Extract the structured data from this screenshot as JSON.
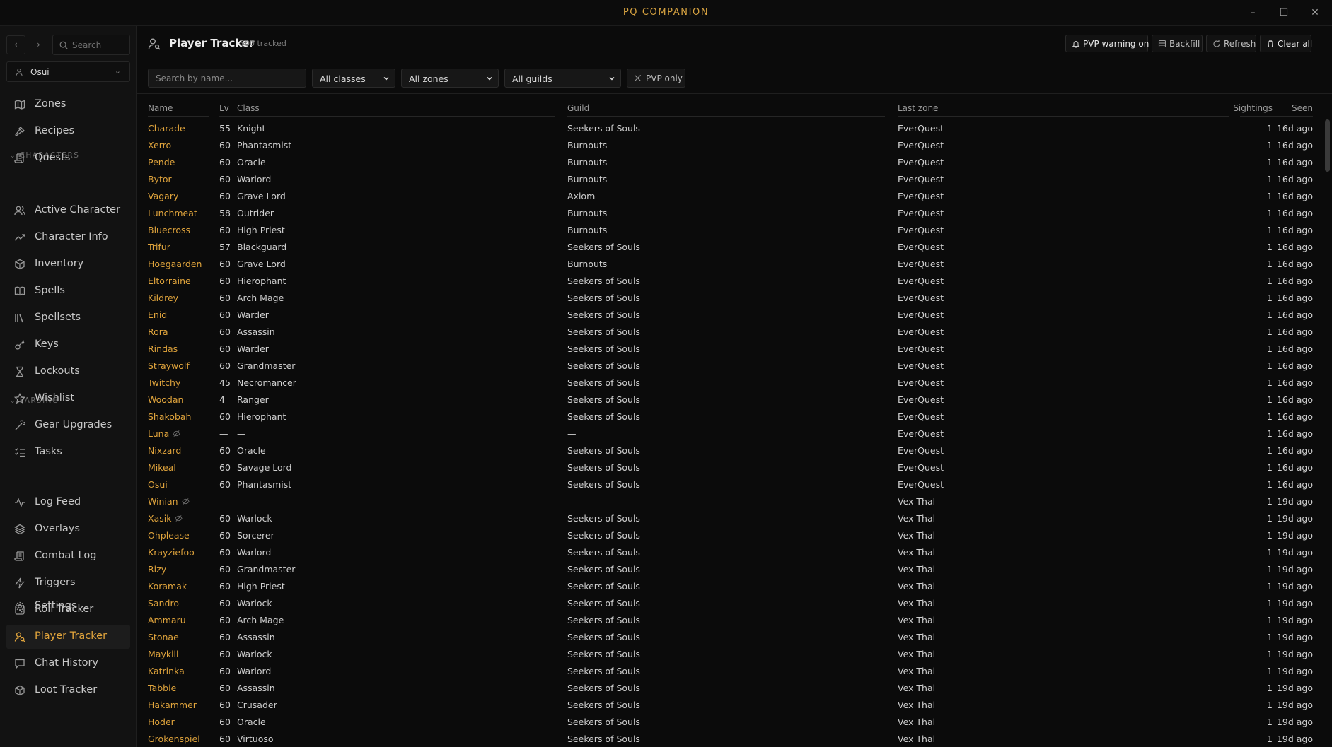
{
  "app": {
    "title": "PQ COMPANION"
  },
  "window": {
    "minimize": "–",
    "maximize": "☐",
    "close": "✕"
  },
  "sidebar": {
    "back": "‹",
    "forward": "›",
    "search_placeholder": "Search",
    "character": "Osui",
    "top_items": [
      {
        "label": "Zones",
        "icon": "map-icon"
      },
      {
        "label": "Recipes",
        "icon": "hammer-icon"
      },
      {
        "label": "Quests",
        "icon": "scroll-icon"
      }
    ],
    "characters_heading": "CHARACTERS",
    "character_items": [
      {
        "label": "Active Character",
        "icon": "users-icon"
      },
      {
        "label": "Character Info",
        "icon": "trending-up-icon"
      },
      {
        "label": "Inventory",
        "icon": "package-icon"
      },
      {
        "label": "Spells",
        "icon": "book-icon"
      },
      {
        "label": "Spellsets",
        "icon": "library-icon"
      },
      {
        "label": "Keys",
        "icon": "key-icon"
      },
      {
        "label": "Lockouts",
        "icon": "hourglass-icon"
      },
      {
        "label": "Wishlist",
        "icon": "star-icon"
      },
      {
        "label": "Gear Upgrades",
        "icon": "wand-icon"
      },
      {
        "label": "Tasks",
        "icon": "list-checks-icon"
      }
    ],
    "parsing_heading": "PARSING",
    "parsing_items": [
      {
        "label": "Log Feed",
        "icon": "activity-icon"
      },
      {
        "label": "Overlays",
        "icon": "layers-icon"
      },
      {
        "label": "Combat Log",
        "icon": "scroll-icon"
      },
      {
        "label": "Triggers",
        "icon": "zap-icon"
      },
      {
        "label": "Roll Tracker",
        "icon": "dice-icon"
      },
      {
        "label": "Player Tracker",
        "icon": "user-search-icon",
        "active": true
      },
      {
        "label": "Chat History",
        "icon": "message-icon"
      },
      {
        "label": "Loot Tracker",
        "icon": "package-icon"
      }
    ],
    "settings": "Settings"
  },
  "header": {
    "title": "Player Tracker",
    "count": "500 tracked",
    "buttons": {
      "pvp": "PVP warning on",
      "backfill": "Backfill",
      "refresh": "Refresh",
      "clear": "Clear all"
    }
  },
  "filters": {
    "search_placeholder": "Search by name...",
    "classes": "All classes",
    "zones": "All zones",
    "guilds": "All guilds",
    "pvp_only": "PVP only"
  },
  "table": {
    "columns": {
      "name": "Name",
      "lv": "Lv",
      "class": "Class",
      "guild": "Guild",
      "zone": "Last zone",
      "sightings": "Sightings",
      "seen": "Seen"
    },
    "rows": [
      {
        "name": "Charade",
        "lv": "55",
        "cls": "Knight",
        "guild": "Seekers of Souls",
        "zone": "EverQuest",
        "sightings": "1",
        "seen": "16d ago"
      },
      {
        "name": "Xerro",
        "lv": "60",
        "cls": "Phantasmist",
        "guild": "Burnouts",
        "zone": "EverQuest",
        "sightings": "1",
        "seen": "16d ago"
      },
      {
        "name": "Pende",
        "lv": "60",
        "cls": "Oracle",
        "guild": "Burnouts",
        "zone": "EverQuest",
        "sightings": "1",
        "seen": "16d ago"
      },
      {
        "name": "Bytor",
        "lv": "60",
        "cls": "Warlord",
        "guild": "Burnouts",
        "zone": "EverQuest",
        "sightings": "1",
        "seen": "16d ago"
      },
      {
        "name": "Vagary",
        "lv": "60",
        "cls": "Grave Lord",
        "guild": "Axiom",
        "zone": "EverQuest",
        "sightings": "1",
        "seen": "16d ago"
      },
      {
        "name": "Lunchmeat",
        "lv": "58",
        "cls": "Outrider",
        "guild": "Burnouts",
        "zone": "EverQuest",
        "sightings": "1",
        "seen": "16d ago"
      },
      {
        "name": "Bluecross",
        "lv": "60",
        "cls": "High Priest",
        "guild": "Burnouts",
        "zone": "EverQuest",
        "sightings": "1",
        "seen": "16d ago"
      },
      {
        "name": "Trifur",
        "lv": "57",
        "cls": "Blackguard",
        "guild": "Seekers of Souls",
        "zone": "EverQuest",
        "sightings": "1",
        "seen": "16d ago"
      },
      {
        "name": "Hoegaarden",
        "lv": "60",
        "cls": "Grave Lord",
        "guild": "Burnouts",
        "zone": "EverQuest",
        "sightings": "1",
        "seen": "16d ago"
      },
      {
        "name": "Eltorraine",
        "lv": "60",
        "cls": "Hierophant",
        "guild": "Seekers of Souls",
        "zone": "EverQuest",
        "sightings": "1",
        "seen": "16d ago"
      },
      {
        "name": "Kildrey",
        "lv": "60",
        "cls": "Arch Mage",
        "guild": "Seekers of Souls",
        "zone": "EverQuest",
        "sightings": "1",
        "seen": "16d ago"
      },
      {
        "name": "Enid",
        "lv": "60",
        "cls": "Warder",
        "guild": "Seekers of Souls",
        "zone": "EverQuest",
        "sightings": "1",
        "seen": "16d ago"
      },
      {
        "name": "Rora",
        "lv": "60",
        "cls": "Assassin",
        "guild": "Seekers of Souls",
        "zone": "EverQuest",
        "sightings": "1",
        "seen": "16d ago"
      },
      {
        "name": "Rindas",
        "lv": "60",
        "cls": "Warder",
        "guild": "Seekers of Souls",
        "zone": "EverQuest",
        "sightings": "1",
        "seen": "16d ago"
      },
      {
        "name": "Straywolf",
        "lv": "60",
        "cls": "Grandmaster",
        "guild": "Seekers of Souls",
        "zone": "EverQuest",
        "sightings": "1",
        "seen": "16d ago"
      },
      {
        "name": "Twitchy",
        "lv": "45",
        "cls": "Necromancer",
        "guild": "Seekers of Souls",
        "zone": "EverQuest",
        "sightings": "1",
        "seen": "16d ago"
      },
      {
        "name": "Woodan",
        "lv": "4",
        "cls": "Ranger",
        "guild": "Seekers of Souls",
        "zone": "EverQuest",
        "sightings": "1",
        "seen": "16d ago"
      },
      {
        "name": "Shakobah",
        "lv": "60",
        "cls": "Hierophant",
        "guild": "Seekers of Souls",
        "zone": "EverQuest",
        "sightings": "1",
        "seen": "16d ago"
      },
      {
        "name": "Luna",
        "anon": true,
        "lv": "—",
        "cls": "—",
        "guild": "—",
        "zone": "EverQuest",
        "sightings": "1",
        "seen": "16d ago"
      },
      {
        "name": "Nixzard",
        "lv": "60",
        "cls": "Oracle",
        "guild": "Seekers of Souls",
        "zone": "EverQuest",
        "sightings": "1",
        "seen": "16d ago"
      },
      {
        "name": "Mikeal",
        "lv": "60",
        "cls": "Savage Lord",
        "guild": "Seekers of Souls",
        "zone": "EverQuest",
        "sightings": "1",
        "seen": "16d ago"
      },
      {
        "name": "Osui",
        "lv": "60",
        "cls": "Phantasmist",
        "guild": "Seekers of Souls",
        "zone": "EverQuest",
        "sightings": "1",
        "seen": "16d ago"
      },
      {
        "name": "Winian",
        "anon": true,
        "lv": "—",
        "cls": "—",
        "guild": "—",
        "zone": "Vex Thal",
        "sightings": "1",
        "seen": "19d ago"
      },
      {
        "name": "Xasik",
        "anon": true,
        "lv": "60",
        "cls": "Warlock",
        "guild": "Seekers of Souls",
        "zone": "Vex Thal",
        "sightings": "1",
        "seen": "19d ago"
      },
      {
        "name": "Ohplease",
        "lv": "60",
        "cls": "Sorcerer",
        "guild": "Seekers of Souls",
        "zone": "Vex Thal",
        "sightings": "1",
        "seen": "19d ago"
      },
      {
        "name": "Krayziefoo",
        "lv": "60",
        "cls": "Warlord",
        "guild": "Seekers of Souls",
        "zone": "Vex Thal",
        "sightings": "1",
        "seen": "19d ago"
      },
      {
        "name": "Rizy",
        "lv": "60",
        "cls": "Grandmaster",
        "guild": "Seekers of Souls",
        "zone": "Vex Thal",
        "sightings": "1",
        "seen": "19d ago"
      },
      {
        "name": "Koramak",
        "lv": "60",
        "cls": "High Priest",
        "guild": "Seekers of Souls",
        "zone": "Vex Thal",
        "sightings": "1",
        "seen": "19d ago"
      },
      {
        "name": "Sandro",
        "lv": "60",
        "cls": "Warlock",
        "guild": "Seekers of Souls",
        "zone": "Vex Thal",
        "sightings": "1",
        "seen": "19d ago"
      },
      {
        "name": "Ammaru",
        "lv": "60",
        "cls": "Arch Mage",
        "guild": "Seekers of Souls",
        "zone": "Vex Thal",
        "sightings": "1",
        "seen": "19d ago"
      },
      {
        "name": "Stonae",
        "lv": "60",
        "cls": "Assassin",
        "guild": "Seekers of Souls",
        "zone": "Vex Thal",
        "sightings": "1",
        "seen": "19d ago"
      },
      {
        "name": "Maykill",
        "lv": "60",
        "cls": "Warlock",
        "guild": "Seekers of Souls",
        "zone": "Vex Thal",
        "sightings": "1",
        "seen": "19d ago"
      },
      {
        "name": "Katrinka",
        "lv": "60",
        "cls": "Warlord",
        "guild": "Seekers of Souls",
        "zone": "Vex Thal",
        "sightings": "1",
        "seen": "19d ago"
      },
      {
        "name": "Tabbie",
        "lv": "60",
        "cls": "Assassin",
        "guild": "Seekers of Souls",
        "zone": "Vex Thal",
        "sightings": "1",
        "seen": "19d ago"
      },
      {
        "name": "Hakammer",
        "lv": "60",
        "cls": "Crusader",
        "guild": "Seekers of Souls",
        "zone": "Vex Thal",
        "sightings": "1",
        "seen": "19d ago"
      },
      {
        "name": "Hoder",
        "lv": "60",
        "cls": "Oracle",
        "guild": "Seekers of Souls",
        "zone": "Vex Thal",
        "sightings": "1",
        "seen": "19d ago"
      },
      {
        "name": "Grokenspiel",
        "lv": "60",
        "cls": "Virtuoso",
        "guild": "Seekers of Souls",
        "zone": "Vex Thal",
        "sightings": "1",
        "seen": "19d ago"
      }
    ]
  },
  "colors": {
    "accent": "#e0a43c",
    "title": "#d9a441",
    "background": "#0b0b0b",
    "sidebar": "#121212"
  }
}
